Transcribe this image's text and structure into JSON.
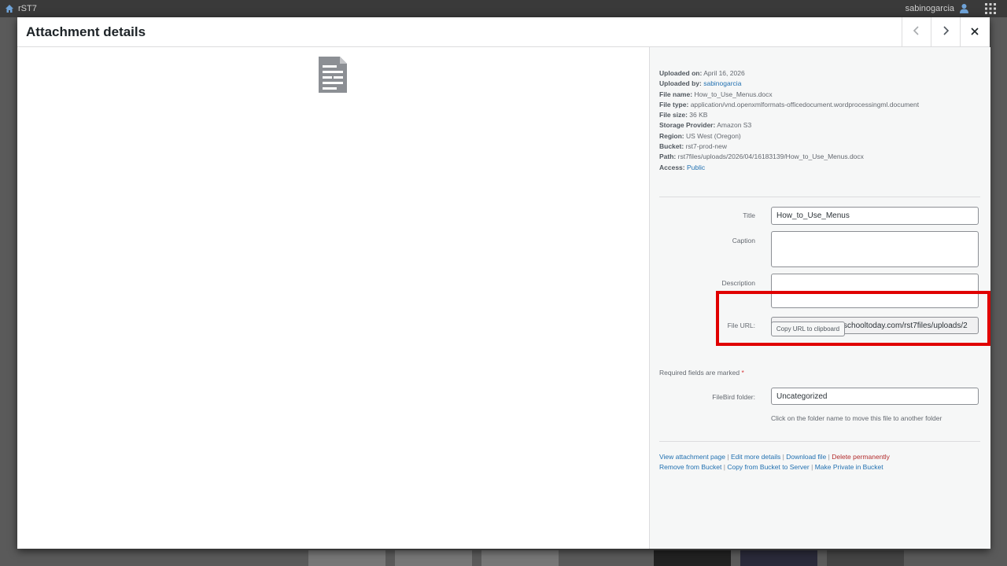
{
  "topbar": {
    "site_name": "rST7",
    "user_name": "sabinogarcia",
    "icons": [
      "home-icon",
      "user-icon",
      "apps-grid-icon"
    ]
  },
  "modal": {
    "title": "Attachment details",
    "icons": [
      "chevron-left-icon",
      "chevron-right-icon",
      "close-icon",
      "document-icon"
    ]
  },
  "meta": {
    "uploaded_on_label": "Uploaded on:",
    "uploaded_on": "April 16, 2026",
    "uploaded_by_label": "Uploaded by:",
    "uploaded_by": "sabinogarcia",
    "file_name_label": "File name:",
    "file_name": "How_to_Use_Menus.docx",
    "file_type_label": "File type:",
    "file_type": "application/vnd.openxmlformats-officedocument.wordprocessingml.document",
    "file_size_label": "File size:",
    "file_size": "36 KB",
    "storage_provider_label": "Storage Provider:",
    "storage_provider": "Amazon S3",
    "region_label": "Region:",
    "region": "US West (Oregon)",
    "bucket_label": "Bucket:",
    "bucket": "rst7-prod-new",
    "path_label": "Path:",
    "path": "rst7files/uploads/2026/04/16183139/How_to_Use_Menus.docx",
    "access_label": "Access:",
    "access": "Public"
  },
  "form": {
    "title_label": "Title",
    "title_value": "How_to_Use_Menus",
    "caption_label": "Caption",
    "caption_value": "",
    "description_label": "Description",
    "description_value": "",
    "file_url_label": "File URL:",
    "file_url_value": "https://assets-rst7.rschooltoday.com/rst7files/uploads/2",
    "copy_button": "Copy URL to clipboard",
    "required_text": "Required fields are marked",
    "required_star": "*",
    "filebird_label": "FileBird folder:",
    "filebird_value": "Uncategorized",
    "filebird_help": "Click on the folder name to move this file to another folder"
  },
  "actions": {
    "view_page": "View attachment page",
    "edit_details": "Edit more details",
    "download": "Download file",
    "delete": "Delete permanently",
    "remove_bucket": "Remove from Bucket",
    "copy_server": "Copy from Bucket to Server",
    "make_private": "Make Private in Bucket",
    "separator": "|"
  },
  "colors": {
    "highlight": "#e00000",
    "link": "#2271b1",
    "danger": "#b32d2e"
  }
}
